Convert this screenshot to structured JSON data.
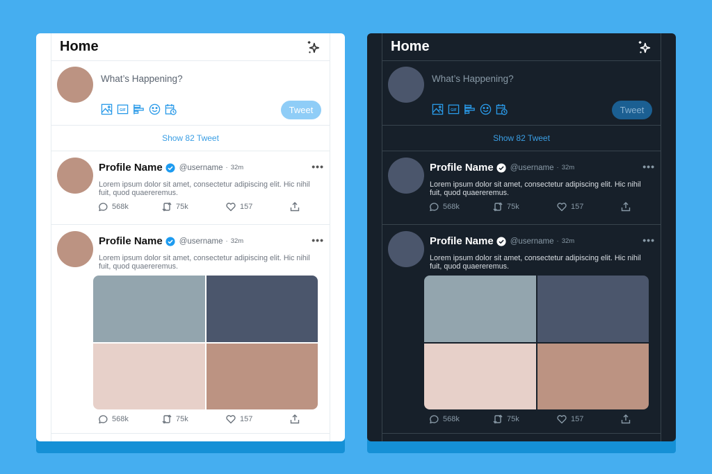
{
  "colors": {
    "background": "#45aef0",
    "accent": "#1d9bf0",
    "light_surface": "#ffffff",
    "dark_surface": "#17202a"
  },
  "panels": [
    {
      "theme": "light",
      "header": {
        "title": "Home",
        "icon": "sparkle-icon"
      },
      "composer": {
        "placeholder": "What’s Happening?",
        "tools": [
          "image-icon",
          "gif-icon",
          "poll-icon",
          "emoji-icon",
          "schedule-icon"
        ],
        "tweet_button": "Tweet"
      },
      "show_more": "Show 82 Tweet",
      "tweets": [
        {
          "name": "Profile Name",
          "handle": "@username",
          "separator": "·",
          "time": "32m",
          "text": "Lorem ipsum dolor sit amet, consectetur adipiscing elit. Hic nihil fuit, quod quaereremus.",
          "replies": "568k",
          "retweets": "75k",
          "likes": "157"
        },
        {
          "name": "Profile Name",
          "handle": "@username",
          "separator": "·",
          "time": "32m",
          "text": "Lorem ipsum dolor sit amet, consectetur adipiscing elit. Hic nihil fuit, quod quaereremus.",
          "media_colors": [
            "#93a5ae",
            "#4b566c",
            "#e7d0c9",
            "#bc9382"
          ],
          "replies": "568k",
          "retweets": "75k",
          "likes": "157"
        }
      ]
    },
    {
      "theme": "dark",
      "header": {
        "title": "Home",
        "icon": "sparkle-icon"
      },
      "composer": {
        "placeholder": "What’s Happening?",
        "tools": [
          "image-icon",
          "gif-icon",
          "poll-icon",
          "emoji-icon",
          "schedule-icon"
        ],
        "tweet_button": "Tweet"
      },
      "show_more": "Show 82 Tweet",
      "tweets": [
        {
          "name": "Profile Name",
          "handle": "@username",
          "separator": "·",
          "time": "32m",
          "text": "Lorem ipsum dolor sit amet, consectetur adipiscing elit. Hic nihil fuit, quod quaereremus.",
          "replies": "568k",
          "retweets": "75k",
          "likes": "157"
        },
        {
          "name": "Profile Name",
          "handle": "@username",
          "separator": "·",
          "time": "32m",
          "text": "Lorem ipsum dolor sit amet, consectetur adipiscing elit. Hic nihil fuit, quod quaereremus.",
          "media_colors": [
            "#93a5ae",
            "#4b566c",
            "#e7d0c9",
            "#bc9382"
          ],
          "replies": "568k",
          "retweets": "75k",
          "likes": "157"
        }
      ]
    }
  ]
}
